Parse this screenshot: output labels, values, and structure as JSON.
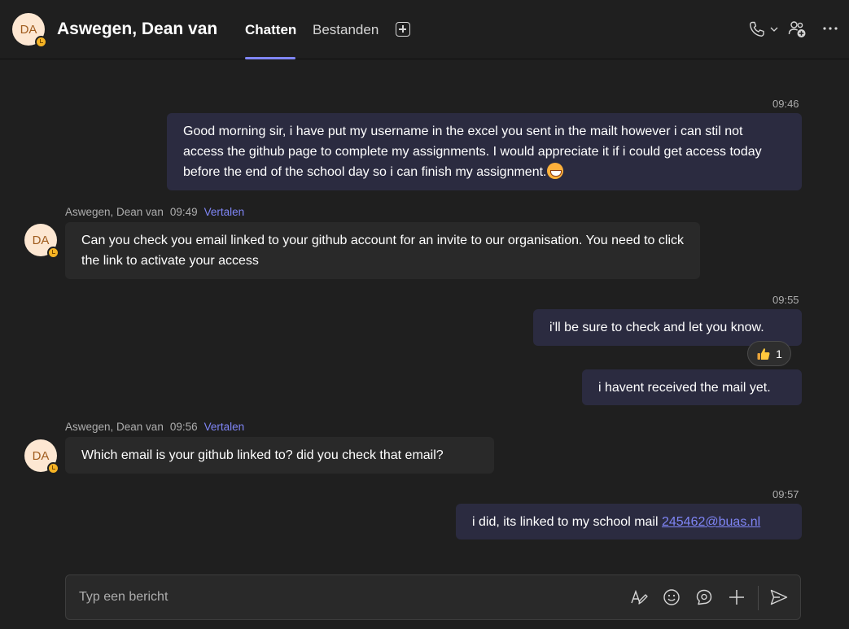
{
  "header": {
    "avatar_initials": "DA",
    "contact_name": "Aswegen, Dean van",
    "tabs": [
      {
        "label": "Chatten",
        "active": true
      },
      {
        "label": "Bestanden",
        "active": false
      }
    ],
    "icons": [
      "add-tab-icon",
      "call-icon",
      "chevron-down-icon",
      "add-people-icon",
      "more-icon"
    ]
  },
  "messages": [
    {
      "direction": "outgoing",
      "time": "09:46",
      "text": "Good morning sir, i have put my username in the excel you sent in the mailt however i can stil not access the github page to complete my assignments. I would appreciate it if i could get access today before the end of the school day so i can finish my assignment.",
      "emoji": "grinning-face-icon"
    },
    {
      "direction": "incoming",
      "sender": "Aswegen, Dean van",
      "time": "09:49",
      "translate_label": "Vertalen",
      "avatar_initials": "DA",
      "text": "Can you check you email linked to your github account for an invite to our organisation. You need to click the link to activate your access"
    },
    {
      "direction": "outgoing",
      "time": "09:55",
      "text": "i'll be sure to check and let you know.",
      "reaction": {
        "icon": "thumbs-up-icon",
        "count": "1"
      }
    },
    {
      "direction": "outgoing",
      "text": "i havent received the mail yet."
    },
    {
      "direction": "incoming",
      "sender": "Aswegen, Dean van",
      "time": "09:56",
      "translate_label": "Vertalen",
      "avatar_initials": "DA",
      "text": "Which email is your github linked to? did you check that email?"
    },
    {
      "direction": "outgoing",
      "time": "09:57",
      "text": "i did, its linked to my school mail ",
      "link": "245462@buas.nl"
    }
  ],
  "compose": {
    "placeholder": "Typ een bericht",
    "icons": [
      "format-icon",
      "emoji-icon",
      "loop-icon",
      "attach-plus-icon",
      "send-icon"
    ]
  },
  "colors": {
    "background": "#1f1f1f",
    "outgoing_bubble": "#2b2b40",
    "incoming_bubble": "#292929",
    "accent": "#7f85f5",
    "avatar_bg": "#fde7d2",
    "status_away": "#f5b324"
  }
}
